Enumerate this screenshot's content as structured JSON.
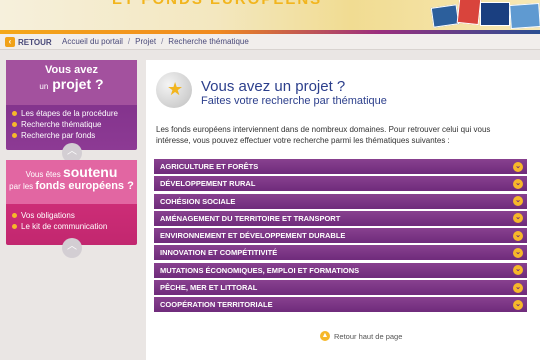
{
  "header": {
    "banner_text": "ET FONDS EUROPÉENS"
  },
  "breadcrumb": {
    "back_label": "RETOUR",
    "items": [
      "Accueil du portail",
      "Projet",
      "Recherche thématique"
    ],
    "separator": "/"
  },
  "sidebar": {
    "box1": {
      "line1": "Vous avez",
      "line2_small": "un",
      "line2_big": "projet ?",
      "items": [
        "Les étapes de la procédure",
        "Recherche thématique",
        "Recherche par fonds"
      ]
    },
    "box2": {
      "line1_small": "Vous êtes",
      "line1_big": "soutenu",
      "line2_small": "par les",
      "line2_big": "fonds européens ?",
      "items": [
        "Vos obligations",
        "Le kit de communication"
      ]
    }
  },
  "main": {
    "title": "Vous avez un projet ?",
    "subtitle": "Faites votre recherche par thématique",
    "intro": "Les fonds européens interviennent dans de nombreux domaines. Pour retrouver celui qui vous intéresse, vous pouvez effectuer votre recherche parmi les thématiques suivantes :",
    "themes": [
      "AGRICULTURE ET FORÊTS",
      "DÉVELOPPEMENT RURAL",
      "COHÉSION SOCIALE",
      "AMÉNAGEMENT DU TERRITOIRE ET TRANSPORT",
      "ENVIRONNEMENT ET DÉVELOPPEMENT DURABLE",
      "INNOVATION ET COMPÉTITIVITÉ",
      "MUTATIONS ÉCONOMIQUES, EMPLOI ET FORMATIONS",
      "PÊCHE, MER ET LITTORAL",
      "COOPÉRATION TERRITORIALE"
    ],
    "back_to_top": "Retour haut de page"
  },
  "colors": {
    "purple": "#7a2d86",
    "pink": "#d7337f",
    "accent": "#f6b82a",
    "title_blue": "#2c3f8c"
  }
}
